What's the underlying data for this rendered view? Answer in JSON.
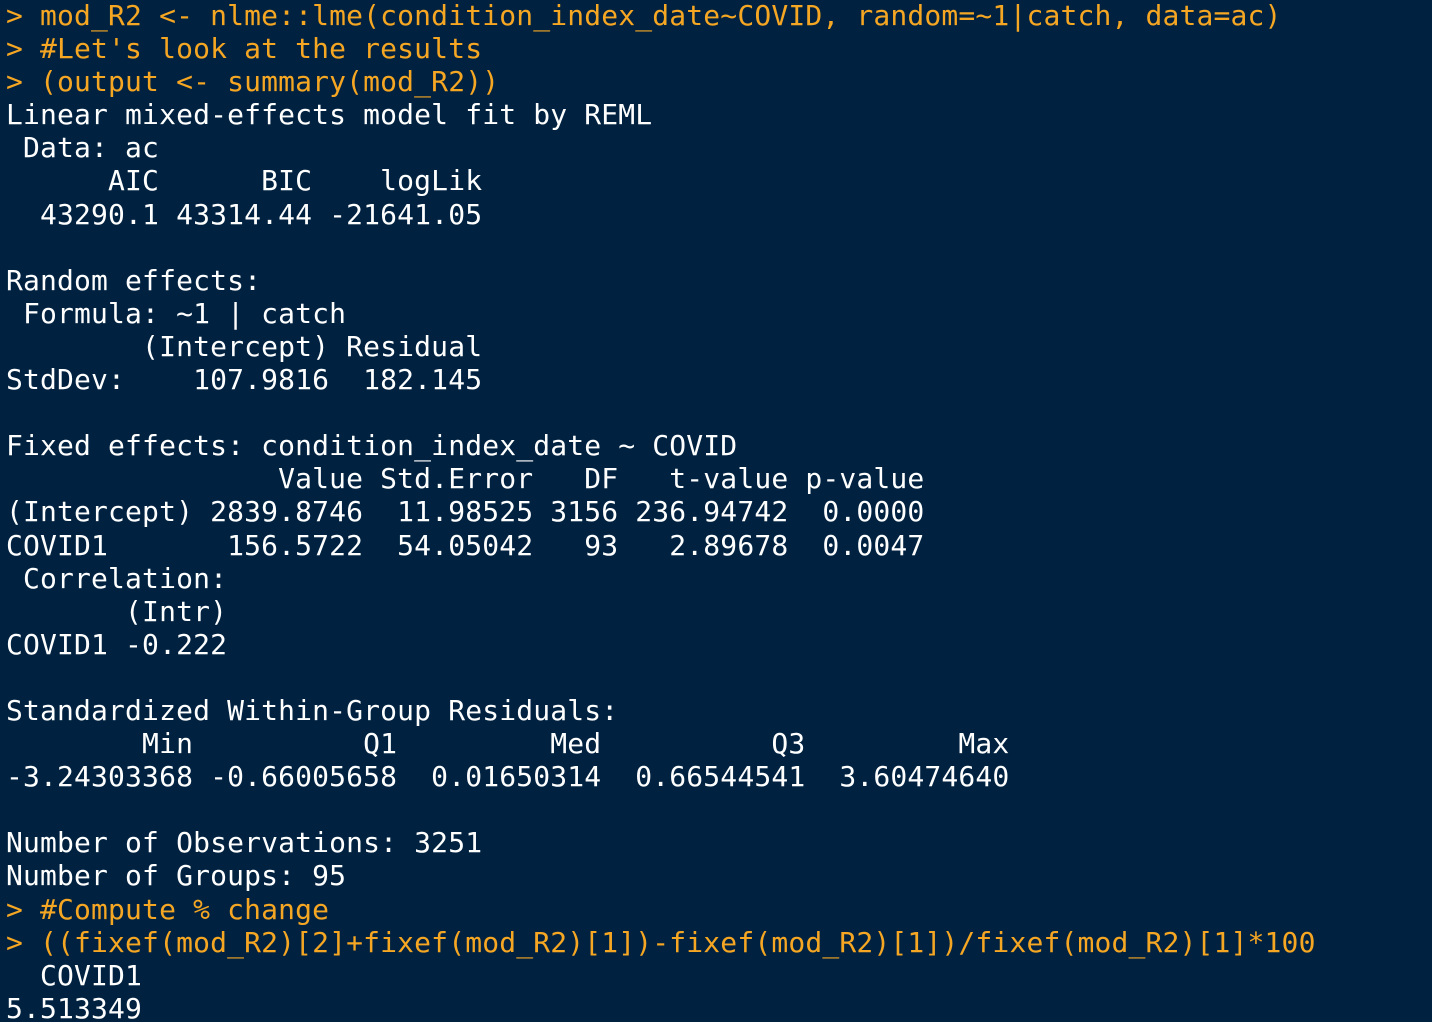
{
  "console": {
    "prompt_symbol": "> ",
    "colors": {
      "background": "#002240",
      "command_text": "#f5a623",
      "output_text": "#ffffff"
    },
    "lines": [
      {
        "type": "cmd",
        "text": "mod_R2 <- nlme::lme(condition_index_date~COVID, random=~1|catch, data=ac)"
      },
      {
        "type": "cmd",
        "text": "#Let's look at the results"
      },
      {
        "type": "cmd",
        "text": "(output <- summary(mod_R2))"
      },
      {
        "type": "out",
        "text": "Linear mixed-effects model fit by REML"
      },
      {
        "type": "out",
        "text": " Data: ac"
      },
      {
        "type": "out",
        "text": "      AIC      BIC    logLik"
      },
      {
        "type": "out",
        "text": "  43290.1 43314.44 -21641.05"
      },
      {
        "type": "out",
        "text": ""
      },
      {
        "type": "out",
        "text": "Random effects:"
      },
      {
        "type": "out",
        "text": " Formula: ~1 | catch"
      },
      {
        "type": "out",
        "text": "        (Intercept) Residual"
      },
      {
        "type": "out",
        "text": "StdDev:    107.9816  182.145"
      },
      {
        "type": "out",
        "text": ""
      },
      {
        "type": "out",
        "text": "Fixed effects: condition_index_date ~ COVID"
      },
      {
        "type": "out",
        "text": "                Value Std.Error   DF   t-value p-value"
      },
      {
        "type": "out",
        "text": "(Intercept) 2839.8746  11.98525 3156 236.94742  0.0000"
      },
      {
        "type": "out",
        "text": "COVID1       156.5722  54.05042   93   2.89678  0.0047"
      },
      {
        "type": "out",
        "text": " Correlation:"
      },
      {
        "type": "out",
        "text": "       (Intr)"
      },
      {
        "type": "out",
        "text": "COVID1 -0.222"
      },
      {
        "type": "out",
        "text": ""
      },
      {
        "type": "out",
        "text": "Standardized Within-Group Residuals:"
      },
      {
        "type": "out",
        "text": "        Min          Q1         Med          Q3         Max"
      },
      {
        "type": "out",
        "text": "-3.24303368 -0.66005658  0.01650314  0.66544541  3.60474640"
      },
      {
        "type": "out",
        "text": ""
      },
      {
        "type": "out",
        "text": "Number of Observations: 3251"
      },
      {
        "type": "out",
        "text": "Number of Groups: 95"
      },
      {
        "type": "cmd",
        "text": "#Compute % change"
      },
      {
        "type": "cmd",
        "text": "((fixef(mod_R2)[2]+fixef(mod_R2)[1])-fixef(mod_R2)[1])/fixef(mod_R2)[1]*100"
      },
      {
        "type": "out",
        "text": "  COVID1"
      },
      {
        "type": "out",
        "text": "5.513349"
      }
    ]
  }
}
